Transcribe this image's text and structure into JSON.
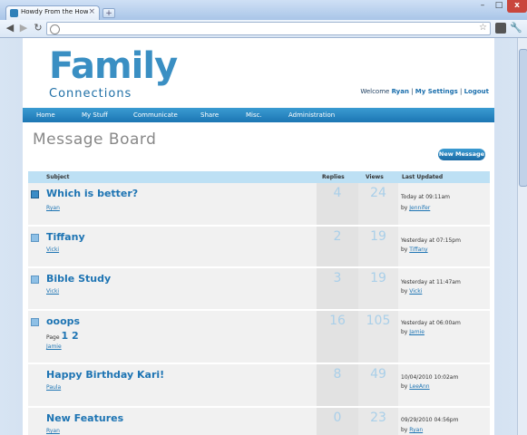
{
  "browser": {
    "tab_title": "Howdy From the Howdy's -...",
    "tab_close": "×",
    "new_tab": "+",
    "win_min": "–",
    "win_max": "□",
    "win_close": "x",
    "back": "◀",
    "forward": "▶",
    "reload": "↻",
    "star": "☆",
    "wrench": "🔧"
  },
  "site": {
    "logo_word": "Family",
    "logo_sub": "Connections",
    "welcome_prefix": "Welcome",
    "user": "Ryan",
    "my_settings": "My Settings",
    "logout": "Logout",
    "separator": " | ",
    "nav": [
      "Home",
      "My Stuff",
      "Communicate",
      "Share",
      "Misc.",
      "Administration"
    ],
    "heading": "Message Board",
    "new_message": "New Message"
  },
  "table": {
    "headers": {
      "subject": "Subject",
      "replies": "Replies",
      "views": "Views",
      "last_updated": "Last Updated"
    },
    "rows": [
      {
        "subject": "Which is better?",
        "author": "Ryan",
        "replies": "4",
        "views": "24",
        "last": "Today at 09:11am",
        "by_prefix": "by",
        "by": "Jennifer",
        "unread": true
      },
      {
        "subject": "Tiffany",
        "author": "Vicki",
        "replies": "2",
        "views": "19",
        "last": "Yesterday at 07:15pm",
        "by_prefix": "by",
        "by": "Tiffany",
        "unread": false
      },
      {
        "subject": "Bible Study",
        "author": "Vicki",
        "replies": "3",
        "views": "19",
        "last": "Yesterday at 11:47am",
        "by_prefix": "by",
        "by": "Vicki",
        "unread": false
      },
      {
        "subject": "ooops",
        "pages_label": "Page",
        "pages": "1 2",
        "author": "Jamie",
        "replies": "16",
        "views": "105",
        "last": "Yesterday at 06:00am",
        "by_prefix": "by",
        "by": "Jamie",
        "unread": false
      },
      {
        "subject": "Happy Birthday Kari!",
        "author": "Paula",
        "replies": "8",
        "views": "49",
        "last": "10/04/2010 10:02am",
        "by_prefix": "by",
        "by": "LeeAnn"
      },
      {
        "subject": "New Features",
        "author": "Ryan",
        "replies": "0",
        "views": "23",
        "last": "09/29/2010 04:56pm",
        "by_prefix": "by",
        "by": "Ryan"
      }
    ]
  },
  "colors": {
    "accent": "#1d74b3",
    "nav_bg": "#2a8ac4",
    "header_bg": "#bde0f4"
  }
}
